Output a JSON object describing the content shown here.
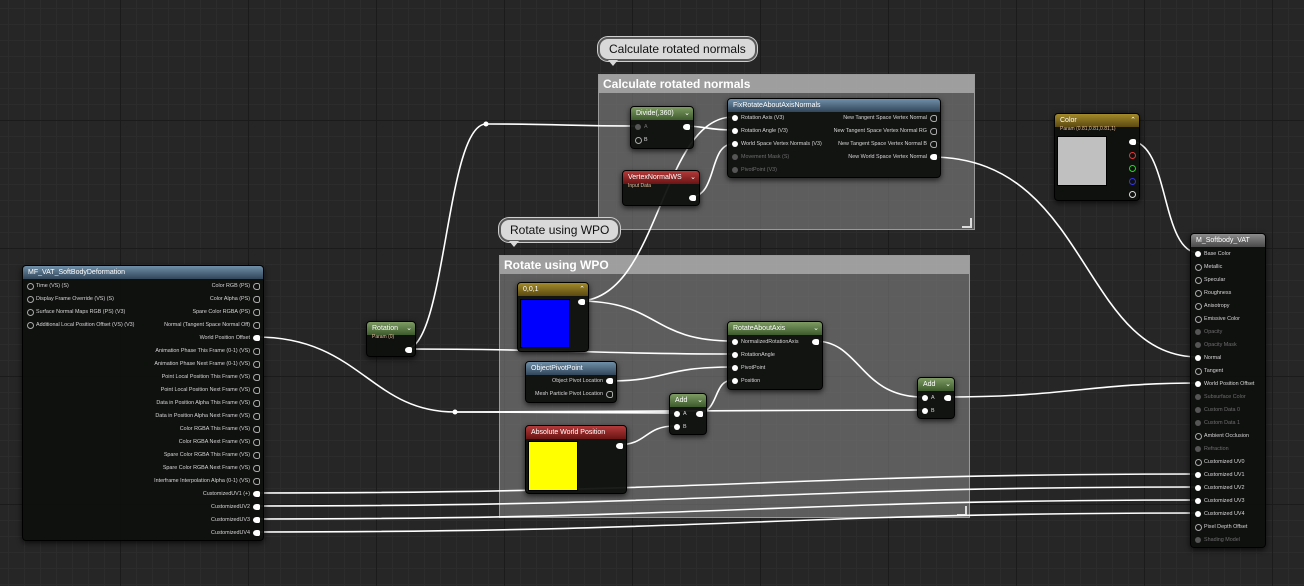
{
  "colors": {
    "swatch_blue": "#0000ff",
    "swatch_yellow": "#ffff00",
    "swatch_color": "#c0c0c0",
    "wire": "#ffffff"
  },
  "comments": {
    "calc_normals": {
      "bubble": "Calculate rotated normals",
      "title": "Calculate rotated normals"
    },
    "rotate_wpo": {
      "bubble": "Rotate using WPO",
      "title": "Rotate using WPO"
    }
  },
  "nodes": {
    "mf_vat": {
      "title": "MF_VAT_SoftBodyDeformation",
      "inputs": [
        "Time (VS) (S)",
        "Display Frame Override (VS) (S)",
        "Surface Normal Maps RGB (PS) (V3)",
        "Additional Local Position Offset (VS) (V3)"
      ],
      "outputs": [
        "Color RGB (PS)",
        "Color Alpha (PS)",
        "Spare Color RGBA (PS)",
        "Normal (Tangent Space Normal Off)",
        "World Position Offset",
        "Animation Phase This Frame (0-1) (VS)",
        "Animation Phase Next Frame (0-1) (VS)",
        "Point Local Position This Frame (VS)",
        "Point Local Position Next Frame (VS)",
        "Data in Position Alpha This Frame (VS)",
        "Data in Position Alpha Next Frame (VS)",
        "Color RGBA This Frame (VS)",
        "Color RGBA Next Frame (VS)",
        "Spare Color RGBA This Frame (VS)",
        "Spare Color RGBA Next Frame (VS)",
        "Interframe Interpolation Alpha (0-1) (VS)",
        "CustomizedUV1 (+)",
        "CustomizedUV2",
        "CustomizedUV3",
        "CustomizedUV4"
      ]
    },
    "rotation": {
      "title": "Rotation",
      "subtitle": "Param (0)"
    },
    "divide": {
      "title": "Divide(,360)",
      "pin_a": "A",
      "pin_b": "B"
    },
    "vertex_normal": {
      "title": "VertexNormalWS",
      "subtitle": "Input Data"
    },
    "fix_rotate": {
      "title": "FixRotateAboutAxisNormals",
      "inputs": [
        "Rotation Axis (V3)",
        "Rotation Angle (V3)",
        "World Space Vertex Normals (V3)",
        "Movement Mask (S)",
        "PivotPoint (V3)"
      ],
      "outputs": [
        "New Tangent Space Vertex Normal",
        "New Tangent Space Vertex Normal RG",
        "New Tangent Space Vertex Normal B",
        "New World Space Vertex Normal"
      ]
    },
    "const_vec": {
      "title": "0,0,1"
    },
    "rotate_about_axis": {
      "title": "RotateAboutAxis",
      "inputs": [
        "NormalizedRotationAxis",
        "RotationAngle",
        "PivotPoint",
        "Position"
      ]
    },
    "object_pivot": {
      "title": "ObjectPivotPoint",
      "outputs": [
        "Object Pivot Location",
        "Mesh Particle Pivot Location"
      ]
    },
    "add_small": {
      "title": "Add",
      "pin_a": "A",
      "pin_b": "B"
    },
    "abs_world_pos": {
      "title": "Absolute World Position"
    },
    "add_right": {
      "title": "Add",
      "pin_a": "A",
      "pin_b": "B"
    },
    "color_param": {
      "title": "Color",
      "subtitle": "Param (0.81,0.81,0.81,1)"
    },
    "material": {
      "title": "M_Softbody_VAT",
      "inputs": [
        "Base Color",
        "Metallic",
        "Specular",
        "Roughness",
        "Anisotropy",
        "Emissive Color",
        "Opacity",
        "Opacity Mask",
        "Normal",
        "Tangent",
        "World Position Offset",
        "Subsurface Color",
        "Custom Data 0",
        "Custom Data 1",
        "Ambient Occlusion",
        "Refraction",
        "Customized UV0",
        "Customized UV1",
        "Customized UV2",
        "Customized UV3",
        "Customized UV4",
        "Pixel Depth Offset",
        "Shading Model"
      ],
      "disabled": [
        "Opacity",
        "Opacity Mask",
        "Subsurface Color",
        "Custom Data 0",
        "Custom Data 1",
        "Refraction",
        "Shading Model"
      ]
    }
  }
}
